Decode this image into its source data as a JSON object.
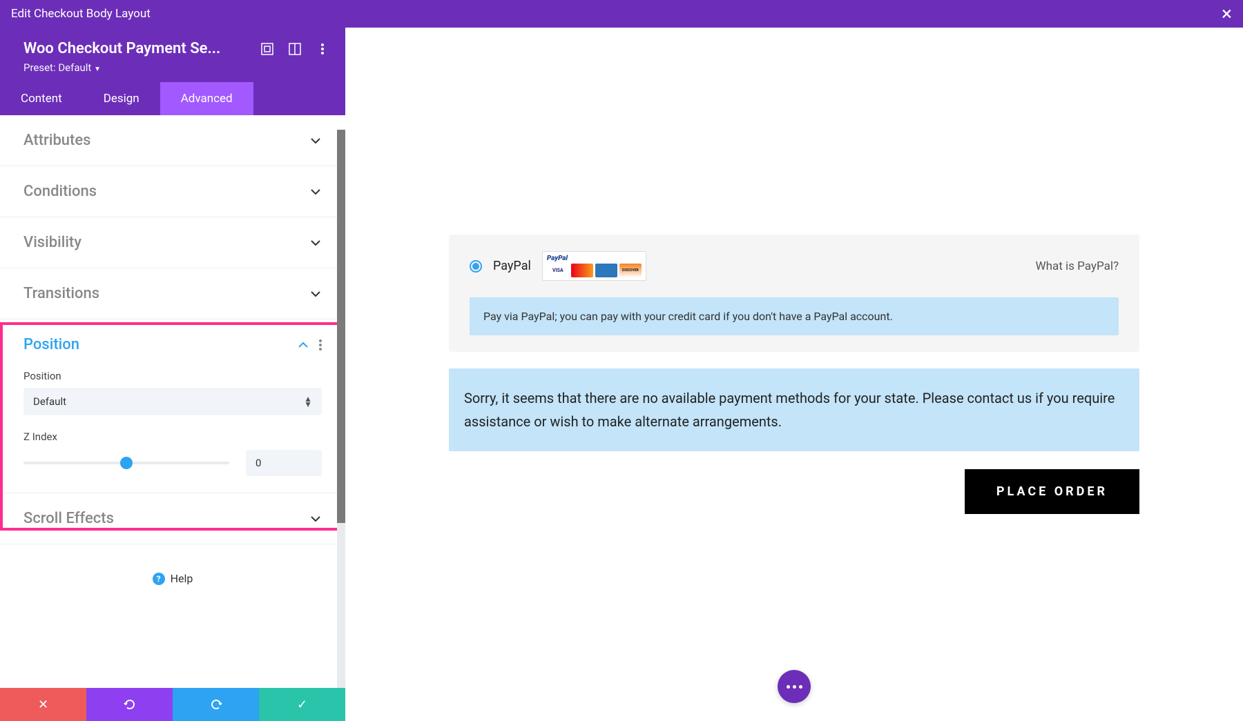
{
  "topbar": {
    "title": "Edit Checkout Body Layout"
  },
  "module": {
    "title": "Woo Checkout Payment Se...",
    "preset": "Preset: Default"
  },
  "tabs": {
    "content": "Content",
    "design": "Design",
    "advanced": "Advanced"
  },
  "sections": {
    "attributes": "Attributes",
    "conditions": "Conditions",
    "visibility": "Visibility",
    "transitions": "Transitions",
    "position": "Position",
    "scroll_effects": "Scroll Effects"
  },
  "position": {
    "position_label": "Position",
    "position_value": "Default",
    "zindex_label": "Z Index",
    "zindex_value": "0",
    "slider_percent": 50
  },
  "help": "Help",
  "preview": {
    "paypal_label": "PayPal",
    "paypal_brand": "PayPal",
    "whatis": "What is PayPal?",
    "paypal_desc": "Pay via PayPal; you can pay with your credit card if you don't have a PayPal account.",
    "notice": "Sorry, it seems that there are no available payment methods for your state. Please contact us if you require assistance or wish to make alternate arrangements.",
    "place_order": "PLACE ORDER",
    "cards": {
      "visa": "VISA",
      "mc": "MasterCard",
      "amex": "",
      "disc": "DISCOVER"
    }
  }
}
